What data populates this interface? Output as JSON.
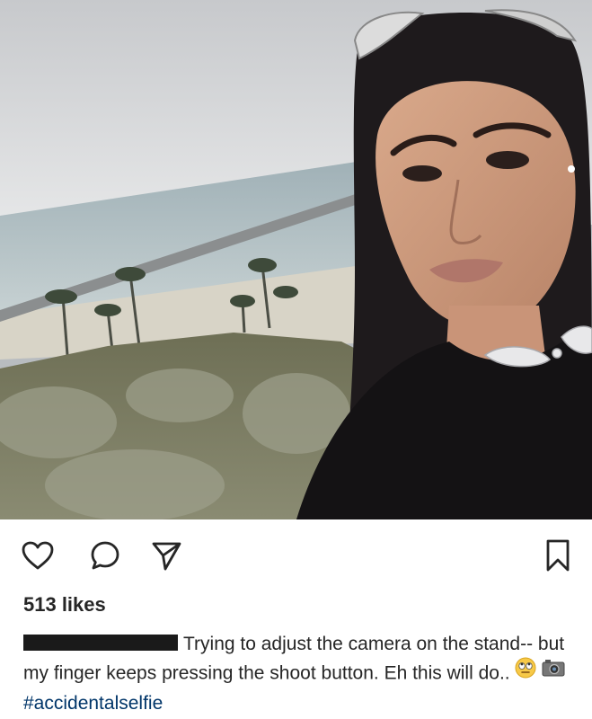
{
  "post": {
    "image_description_icon": "selfie-photo",
    "likes_text": "513 likes",
    "username_redacted": "username",
    "caption_text": "Trying to adjust the camera on the stand-- but my finger keeps pressing the shoot button. Eh this will do..",
    "emoji_1": "eye-roll-emoji",
    "emoji_2": "camera-emoji",
    "hashtag": "#accidentalselfie"
  },
  "actions": {
    "like_icon": "heart-icon",
    "comment_icon": "comment-icon",
    "share_icon": "share-icon",
    "save_icon": "bookmark-icon"
  },
  "colors": {
    "text": "#262626",
    "hashtag": "#003569",
    "redaction": "#1a1a1a"
  }
}
